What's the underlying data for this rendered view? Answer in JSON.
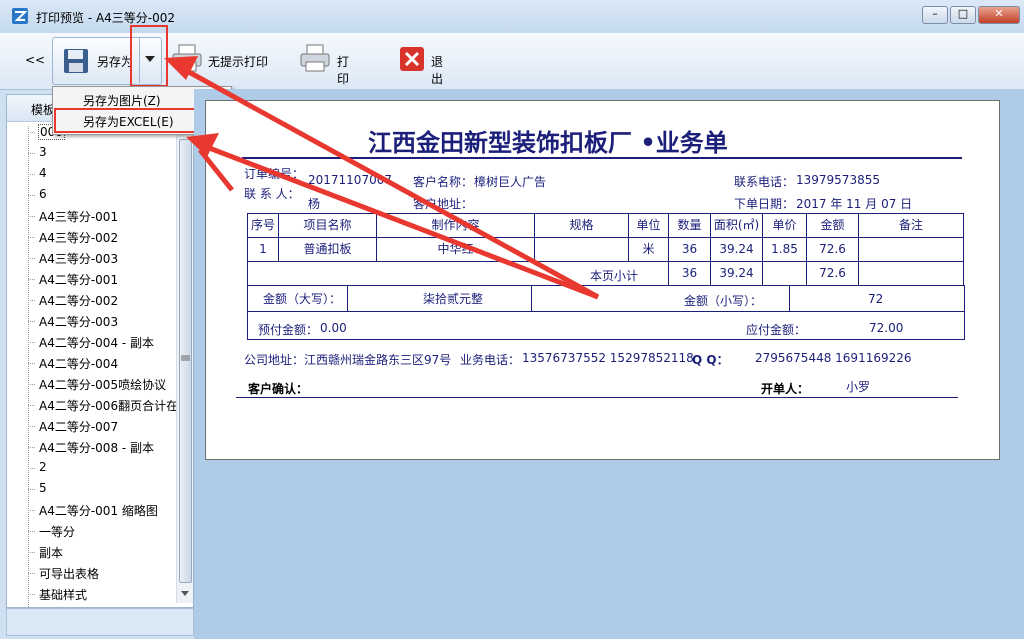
{
  "window": {
    "title": "打印预览 - A4三等分-002",
    "minimize": "–",
    "maximize": "□",
    "close": "✕"
  },
  "toolbar": {
    "collapse": "<<",
    "save_as": "另存为",
    "print_direct": "无提示打印",
    "print": "打印",
    "exit": "退出"
  },
  "menu": {
    "items": [
      "另存为图片(Z)",
      "另存为EXCEL(E)"
    ]
  },
  "left_panel": {
    "header": "模板",
    "items": [
      "000",
      "3",
      "4",
      "6",
      "A4三等分-001",
      "A4三等分-002",
      "A4三等分-003",
      "A4二等分-001",
      "A4二等分-002",
      "A4二等分-003",
      "A4二等分-004 - 副本",
      "A4二等分-004",
      "A4二等分-005喷绘协议",
      "A4二等分-006翻页合计在",
      "A4二等分-007",
      "A4二等分-008 - 副本",
      "2",
      "5",
      "A4二等分-001 缩略图",
      "一等分",
      "副本",
      "可导出表格",
      "基础样式"
    ]
  },
  "document": {
    "title": "江西金田新型装饰扣板厂 •业务单",
    "order_no_label": "订单编号：",
    "order_no": "20171107007",
    "customer_label": "客户名称：",
    "customer": "樟树巨人广告",
    "phone_label": "联系电话：",
    "phone": "13979573855",
    "contact_label": "联 系 人：",
    "contact": "杨",
    "address_label": "客户地址：",
    "date_label": "下单日期：",
    "date": "2017 年 11 月 07 日",
    "table_headers": [
      "序号",
      "项目名称",
      "制作内容",
      "规格",
      "单位",
      "数量",
      "面积(㎡)",
      "单价",
      "金额",
      "备注"
    ],
    "row": [
      "1",
      "普通扣板",
      "中华红",
      "",
      "米",
      "36",
      "39.24",
      "1.85",
      "72.6",
      ""
    ],
    "subtotal_label": "本页小计",
    "subtotal": [
      "36",
      "39.24",
      "72.6"
    ],
    "amount_upper_label": "金额（大写）：",
    "amount_upper": "柒拾贰元整",
    "amount_lower_label": "金额（小写）：",
    "amount_lower": "72",
    "prepaid_label": "预付金额：",
    "prepaid": "0.00",
    "payable_label": "应付金额：",
    "payable": "72.00",
    "company_address": "公司地址：江西赣州瑞金路东三区97号",
    "biz_phone_label": "业务电话：",
    "biz_phone": "13576737552  15297852118",
    "qq_label": "Q Q：",
    "qq": "2795675448    1691169226",
    "confirm_label": "客户确认：",
    "issuer_label": "开单人：",
    "issuer": "小罗"
  },
  "colors": {
    "accent_red": "#e8382f",
    "doc_navy": "#1b1f7a"
  }
}
